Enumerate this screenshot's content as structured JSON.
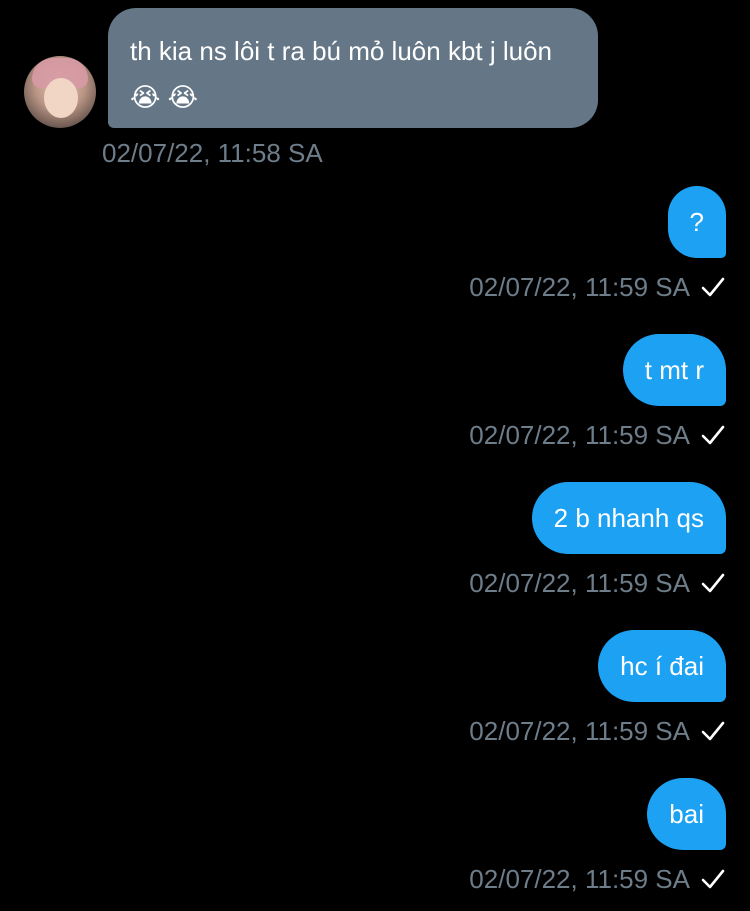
{
  "conversation": {
    "incoming": {
      "avatar_icon": "user-avatar",
      "text": "th kia ns lôi t ra bú mỏ luôn kbt j luôn😭 😭",
      "timestamp": "02/07/22, 11:58 SA"
    },
    "outgoing": [
      {
        "text": "?",
        "timestamp": "02/07/22, 11:59 SA",
        "status_icon": "sent-check-icon"
      },
      {
        "text": "t mt r",
        "timestamp": "02/07/22, 11:59 SA",
        "status_icon": "sent-check-icon"
      },
      {
        "text": "2 b nhanh qs",
        "timestamp": "02/07/22, 11:59 SA",
        "status_icon": "sent-check-icon"
      },
      {
        "text": "hc í đai",
        "timestamp": "02/07/22, 11:59 SA",
        "status_icon": "sent-check-icon"
      },
      {
        "text": "bai",
        "timestamp": "02/07/22, 11:59 SA",
        "status_icon": "sent-check-icon"
      }
    ]
  },
  "colors": {
    "background": "#000000",
    "incoming_bubble": "#657786",
    "outgoing_bubble": "#1da1f2",
    "timestamp_text": "#6e7d8a",
    "check": "#ffffff"
  }
}
